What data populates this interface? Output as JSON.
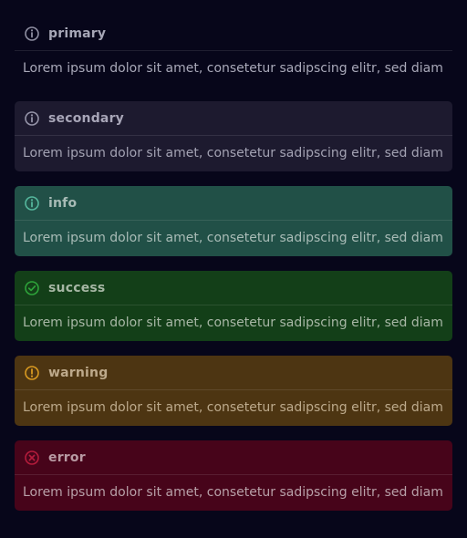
{
  "alerts": [
    {
      "variant": "primary",
      "title": "primary",
      "icon": "info-icon",
      "icon_color": "#8f8fa2",
      "text": "Lorem ipsum dolor sit amet, consetetur sadipscing elitr, sed diam"
    },
    {
      "variant": "secondary",
      "title": "secondary",
      "icon": "info-icon",
      "icon_color": "#9594a8",
      "text": "Lorem ipsum dolor sit amet, consetetur sadipscing elitr, sed diam"
    },
    {
      "variant": "info",
      "title": "info",
      "icon": "info-icon",
      "icon_color": "#55b79d",
      "text": "Lorem ipsum dolor sit amet, consetetur sadipscing elitr, sed diam"
    },
    {
      "variant": "success",
      "title": "success",
      "icon": "check-circle-icon",
      "icon_color": "#2ea33a",
      "text": "Lorem ipsum dolor sit amet, consetetur sadipscing elitr, sed diam"
    },
    {
      "variant": "warning",
      "title": "warning",
      "icon": "alert-circle-icon",
      "icon_color": "#d99a21",
      "text": "Lorem ipsum dolor sit amet, consetetur sadipscing elitr, sed diam"
    },
    {
      "variant": "error",
      "title": "error",
      "icon": "x-circle-icon",
      "icon_color": "#b41c3c",
      "text": "Lorem ipsum dolor sit amet, consetetur sadipscing elitr, sed diam"
    }
  ]
}
